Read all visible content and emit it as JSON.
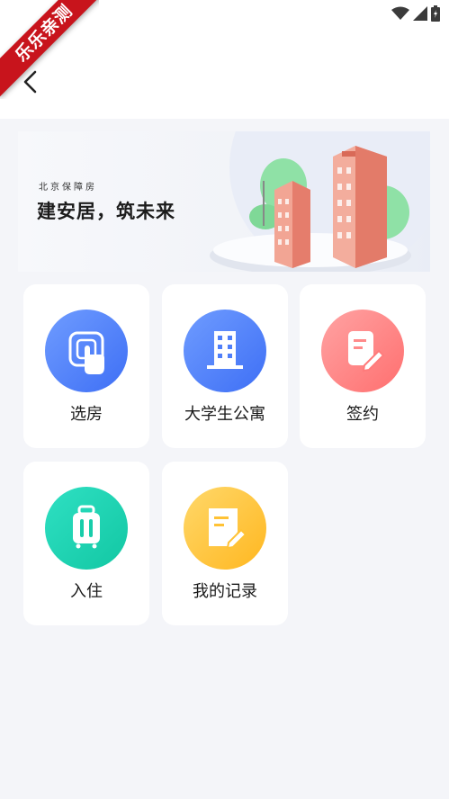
{
  "watermark": {
    "text": "乐乐亲测",
    "color": "#c8141c"
  },
  "status_bar": {
    "icons": [
      "wifi-icon",
      "signal-icon",
      "battery-icon"
    ]
  },
  "header": {
    "back_icon": "chevron-left-icon"
  },
  "banner": {
    "subtitle": "北京保障房",
    "title": "建安居，筑未来"
  },
  "menu": {
    "items": [
      {
        "label": "选房",
        "icon": "touch-select-icon",
        "color": "#4f7ffa"
      },
      {
        "label": "大学生公寓",
        "icon": "building-icon",
        "color": "#4f7ffa"
      },
      {
        "label": "签约",
        "icon": "sign-document-icon",
        "color": "#ff7b7b"
      },
      {
        "label": "入住",
        "icon": "luggage-icon",
        "color": "#17cdaa"
      },
      {
        "label": "我的记录",
        "icon": "record-edit-icon",
        "color": "#ffc235"
      }
    ]
  }
}
